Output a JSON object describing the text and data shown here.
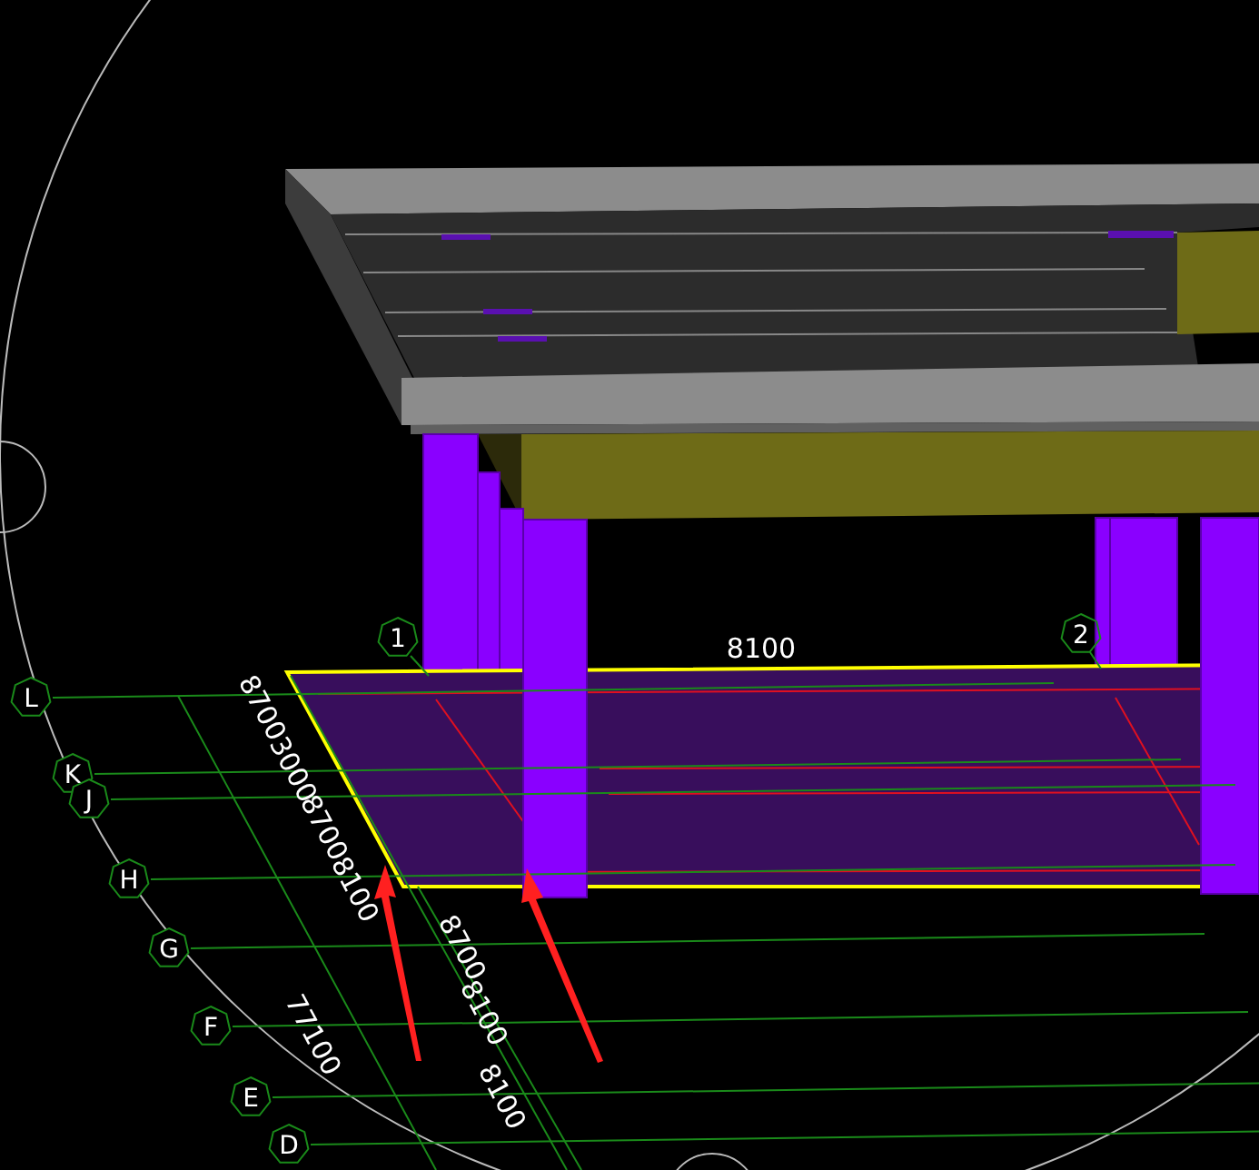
{
  "viewport": {
    "column_axes": [
      {
        "label": "1"
      },
      {
        "label": "2"
      }
    ],
    "row_axes": [
      {
        "label": "L"
      },
      {
        "label": "K"
      },
      {
        "label": "J"
      },
      {
        "label": "H"
      },
      {
        "label": "G"
      },
      {
        "label": "F"
      },
      {
        "label": "E"
      },
      {
        "label": "D"
      }
    ],
    "top_dimension": "8100",
    "row_dimensions": [
      "8700",
      "3000",
      "8700",
      "8100",
      "8700",
      "8100",
      "8100"
    ],
    "total_dimension": "77100"
  }
}
